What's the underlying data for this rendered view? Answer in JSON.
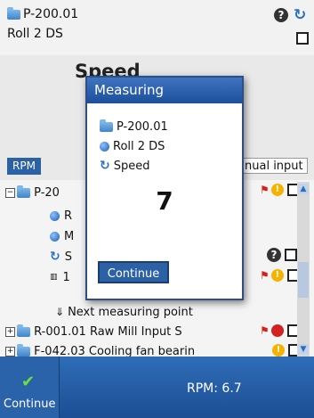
{
  "header": {
    "point_id": "P-200.01",
    "point_name": "Roll 2 DS",
    "background_title": "Speed"
  },
  "rpm_tab": "RPM",
  "manual_input": "nual input",
  "tree": [
    {
      "label": "P-20",
      "kind": "folder"
    },
    {
      "label": "R",
      "kind": "dot"
    },
    {
      "label": "M",
      "kind": "dot"
    },
    {
      "label": "S",
      "kind": "refresh"
    },
    {
      "label": "1",
      "kind": "hd"
    },
    {
      "label": "Next measuring point",
      "kind": "arrow"
    },
    {
      "label": "R-001.01 Raw Mill Input S",
      "kind": "folder"
    },
    {
      "label": "F-042.03 Cooling fan bearin",
      "kind": "folder"
    }
  ],
  "dialog": {
    "title": "Measuring",
    "point_id": "P-200.01",
    "point_name": "Roll 2 DS",
    "measurement": "Speed",
    "value": "7",
    "continue_label": "Continue"
  },
  "bottom": {
    "continue_label": "Continue",
    "rpm": "RPM: 6.7"
  },
  "colors": {
    "accent": "#2c61a6",
    "warning": "#f5b200",
    "alarm": "#d32020"
  }
}
